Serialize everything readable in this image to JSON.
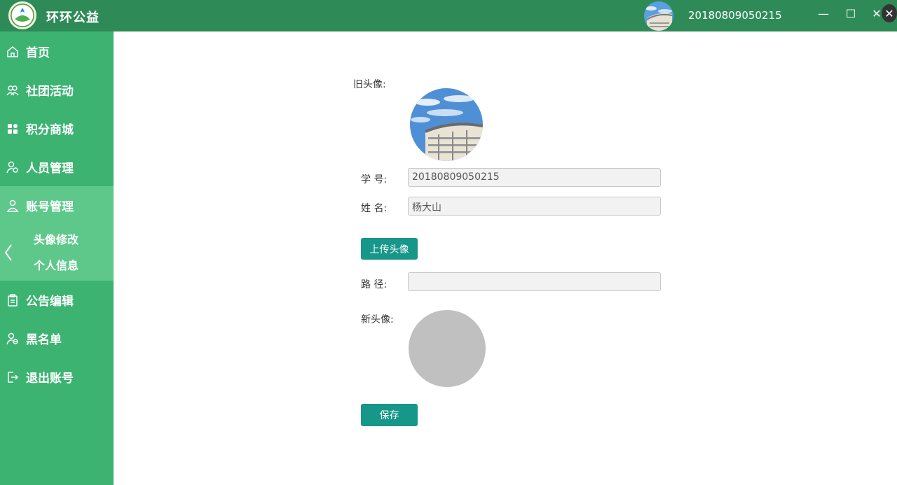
{
  "app": {
    "title": "环环公益",
    "user_id": "20180809050215"
  },
  "window": {
    "minimize": "—",
    "maximize": "☐",
    "close": "✕"
  },
  "sidebar": {
    "items": [
      {
        "label": "首页",
        "icon": "home-icon"
      },
      {
        "label": "社团活动",
        "icon": "group-icon"
      },
      {
        "label": "积分商城",
        "icon": "apps-icon"
      },
      {
        "label": "人员管理",
        "icon": "user-settings-icon"
      },
      {
        "label": "账号管理",
        "icon": "user-icon"
      },
      {
        "label": "公告编辑",
        "icon": "clipboard-icon"
      },
      {
        "label": "黑名单",
        "icon": "user-blocked-icon"
      },
      {
        "label": "退出账号",
        "icon": "logout-icon"
      }
    ],
    "submenu": [
      {
        "label": "头像修改"
      },
      {
        "label": "个人信息"
      }
    ]
  },
  "form": {
    "old_avatar_label": "旧头像:",
    "student_id_label": "学  号:",
    "student_id_value": "20180809050215",
    "name_label": "姓  名:",
    "name_value": "杨大山",
    "upload_button": "上传头像",
    "path_label": "路  径:",
    "path_value": "",
    "new_avatar_label": "新头像:",
    "save_button": "保存"
  },
  "colors": {
    "titlebar": "#2e8b57",
    "sidebar": "#3cb371",
    "active": "#5ec88a",
    "button": "#17968a"
  }
}
